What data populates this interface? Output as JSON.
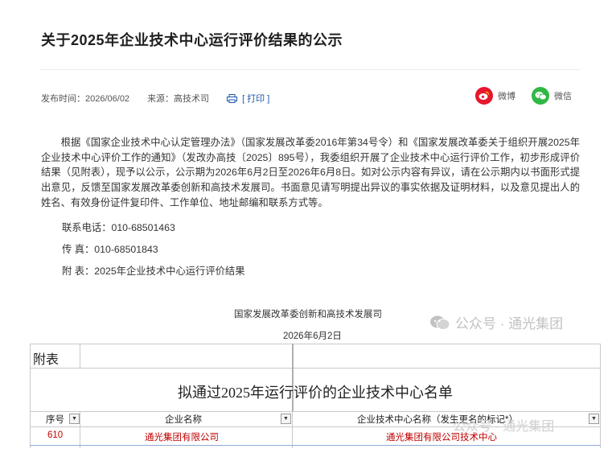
{
  "article": {
    "title": "关于2025年企业技术中心运行评价结果的公示",
    "publish_time": "发布时间：2026/06/02",
    "source": "来源：高技术司",
    "print_label": "[ 打印 ]"
  },
  "share": {
    "weibo_label": "微博",
    "wechat_label": "微信"
  },
  "body": {
    "paragraph": "根据《国家企业技术中心认定管理办法》（国家发展改革委2016年第34号令）和《国家发展改革委关于组织开展2025年企业技术中心评价工作的通知》（发改办高技〔2025〕895号），我委组织开展了企业技术中心运行评价工作，初步形成评价结果（见附表），现予以公示，公示期为2026年6月2日至2026年6月8日。如对公示内容有异议，请在公示期内以书面形式提出意见，反馈至国家发展改革委创新和高技术发展司。书面意见请写明提出异议的事实依据及证明材料，以及意见提出人的姓名、有效身份证件复印件、工作单位、地址邮编和联系方式等。",
    "phone": "联系电话：010-68501463",
    "fax": "传  真：010-68501843",
    "attachment": "附  表：2025年企业技术中心运行评价结果",
    "signature_org": "国家发展改革委创新和高技术发展司",
    "signature_date": "2026年6月2日"
  },
  "watermark": {
    "text": "公众号 · 通光集团",
    "text2": "公众号 · 通光集团"
  },
  "sheet": {
    "annex_label": "附表",
    "list_title": "拟通过2025年运行评价的企业技术中心名单",
    "headers": [
      "序号",
      "企业名称",
      "企业技术中心名称（发生更名的标记*）"
    ],
    "rows": [
      [
        "610",
        "通光集团有限公司",
        "通光集团有限公司技术中心"
      ]
    ]
  },
  "colors": {
    "weibo": "#e6162d",
    "wechat": "#2fb845",
    "row_text": "#c00000",
    "link": "#1a56a8"
  }
}
